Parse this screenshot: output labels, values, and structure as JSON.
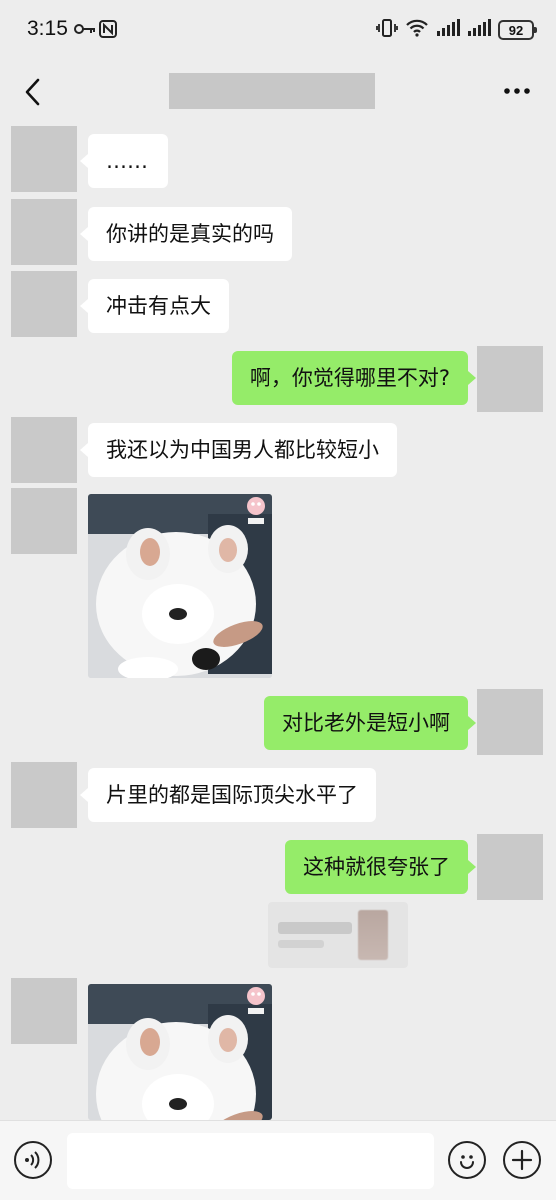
{
  "status_bar": {
    "time": "3:15",
    "battery": "92",
    "icons": [
      "key-icon",
      "nfc-icon",
      "vibrate-icon",
      "wifi-icon",
      "signal-icon",
      "signal-icon",
      "battery-icon"
    ]
  },
  "header": {
    "title": "",
    "back_icon": "chevron-left-icon",
    "more_icon": "more-dots-icon"
  },
  "messages": [
    {
      "side": "in",
      "type": "text",
      "text": "……"
    },
    {
      "side": "in",
      "type": "text",
      "text": "你讲的是真实的吗"
    },
    {
      "side": "in",
      "type": "text",
      "text": "冲击有点大"
    },
    {
      "side": "out",
      "type": "text",
      "text": "啊，你觉得哪里不对?"
    },
    {
      "side": "in",
      "type": "text",
      "text": "我还以为中国男人都比较短小"
    },
    {
      "side": "in",
      "type": "sticker",
      "sticker": "white-puppy-sticker"
    },
    {
      "side": "out",
      "type": "text",
      "text": "对比老外是短小啊"
    },
    {
      "side": "in",
      "type": "text",
      "text": "片里的都是国际顶尖水平了"
    },
    {
      "side": "out",
      "type": "text",
      "text": "这种就很夸张了"
    },
    {
      "side": "out",
      "type": "quote",
      "quote": "blurred-quote-card"
    },
    {
      "side": "in",
      "type": "sticker",
      "sticker": "white-puppy-sticker"
    }
  ],
  "input_bar": {
    "value": "",
    "placeholder": "",
    "voice_icon": "voice-icon",
    "emoji_icon": "emoji-icon",
    "plus_icon": "plus-icon"
  },
  "colors": {
    "background": "#ededed",
    "incoming_bubble": "#ffffff",
    "outgoing_bubble": "#95ec69",
    "avatar_placeholder": "#c9c9c9"
  }
}
